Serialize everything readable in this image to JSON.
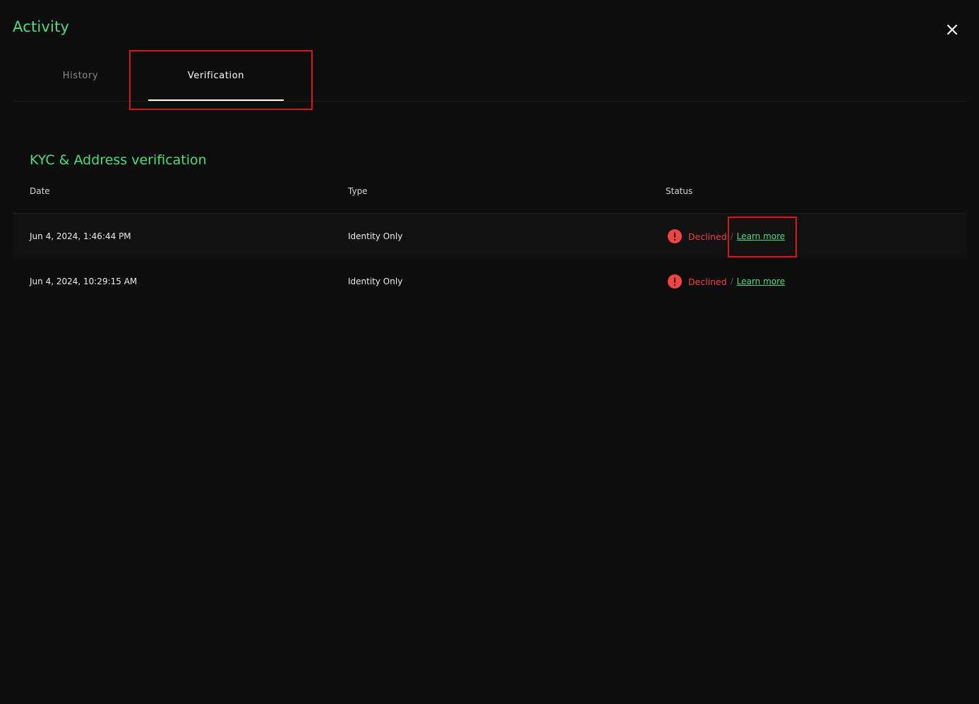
{
  "header": {
    "title": "Activity",
    "close_icon": "close-icon"
  },
  "tabs": [
    {
      "label": "History",
      "active": false
    },
    {
      "label": "Verification",
      "active": true
    }
  ],
  "section": {
    "title": "KYC & Address verification"
  },
  "table": {
    "columns": [
      "Date",
      "Type",
      "Status"
    ],
    "rows": [
      {
        "date": "Jun 4, 2024, 1:46:44 PM",
        "type": "Identity Only",
        "status": "Declined",
        "separator": "/",
        "link": "Learn more"
      },
      {
        "date": "Jun 4, 2024, 10:29:15 AM",
        "type": "Identity Only",
        "status": "Declined",
        "separator": "/",
        "link": "Learn more"
      }
    ]
  },
  "colors": {
    "accent": "#4ade80",
    "declined": "#ef4444",
    "background": "#0d0d0d",
    "annotation": "#e0101a"
  }
}
